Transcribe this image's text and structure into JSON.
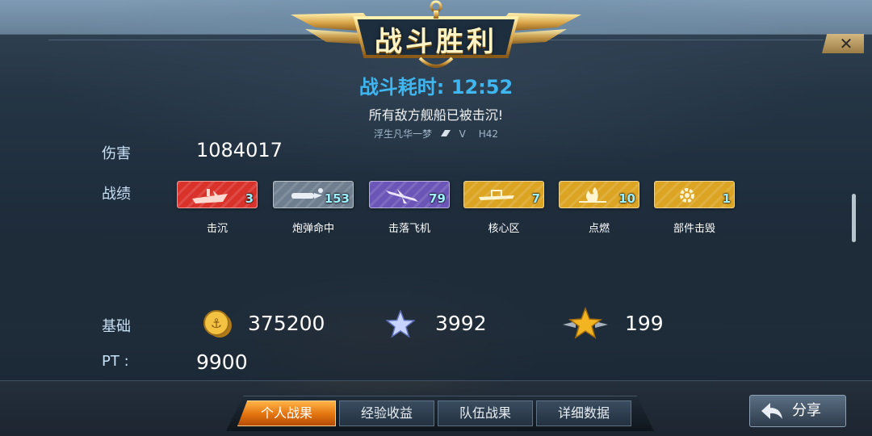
{
  "title": "战斗胜利",
  "close_icon": "close-icon",
  "battle_time_label": "战斗耗时:",
  "battle_time_value": "12:52",
  "result_message": "所有敌方舰船已被击沉!",
  "player": {
    "name": "浮生凡华一梦",
    "rank": "V",
    "ship": "H42"
  },
  "damage": {
    "label": "伤害",
    "value": "1084017"
  },
  "record": {
    "label": "战绩",
    "medals": [
      {
        "name": "击沉",
        "count": "3",
        "color": "#d8322a",
        "icon": "sinking-ship-icon"
      },
      {
        "name": "炮弹命中",
        "count": "153",
        "color": "#6f7f90",
        "icon": "shell-hit-icon"
      },
      {
        "name": "击落飞机",
        "count": "79",
        "color": "#6b56b8",
        "icon": "plane-down-icon"
      },
      {
        "name": "核心区",
        "count": "7",
        "color": "#dca423",
        "icon": "citadel-icon"
      },
      {
        "name": "点燃",
        "count": "10",
        "color": "#dca423",
        "icon": "fire-icon"
      },
      {
        "name": "部件击毁",
        "count": "1",
        "color": "#dca423",
        "icon": "gear-icon"
      }
    ]
  },
  "base": {
    "label": "基础",
    "coins": "375200",
    "ship_xp": "3992",
    "captain_xp": "199"
  },
  "pt": {
    "label": "PT :",
    "value": "9900"
  },
  "tabs": [
    "个人战果",
    "经验收益",
    "队伍战果",
    "详细数据"
  ],
  "active_tab": 0,
  "share_label": "分享",
  "colors": {
    "accent_blue": "#3fb6f0",
    "active_tab": "#e2730f",
    "gold": "#e0b050"
  }
}
